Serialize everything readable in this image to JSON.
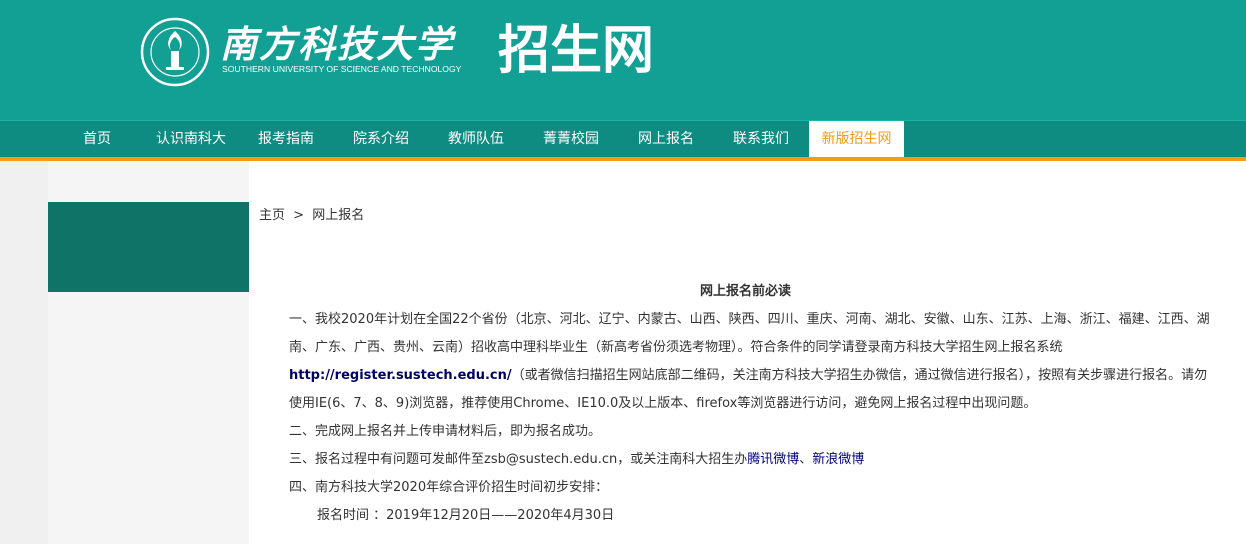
{
  "header": {
    "logo_cn": "南方科技大学",
    "logo_en": "SOUTHERN UNIVERSITY OF SCIENCE AND TECHNOLOGY",
    "site_title": "招生网"
  },
  "nav": {
    "items": [
      {
        "label": "首页"
      },
      {
        "label": "认识南科大"
      },
      {
        "label": "报考指南"
      },
      {
        "label": "院系介绍"
      },
      {
        "label": "教师队伍"
      },
      {
        "label": "菁菁校园"
      },
      {
        "label": "网上报名"
      },
      {
        "label": "联系我们"
      },
      {
        "label": "新版招生网"
      }
    ],
    "active_color": "#f39b18"
  },
  "breadcrumb": {
    "home": "主页",
    "sep": ">",
    "current": "网上报名"
  },
  "notice": {
    "title": "网上报名前必读",
    "p1_text": "一、我校2020年计划在全国22个省份（北京、河北、辽宁、内蒙古、山西、陕西、四川、重庆、河南、湖北、安徽、山东、江苏、上海、浙江、福建、江西、湖南、广东、广西、贵州、云南）招收高中理科毕业生（新高考省份须选考物理）。符合条件的同学请登录南方科技大学招生网上报名系统",
    "p1_link": "http://register.sustech.edu.cn/",
    "p1_tail": "（或者微信扫描招生网站底部二维码，关注南方科技大学招生办微信，通过微信进行报名），按照有关步骤进行报名。请勿使用IE(6、7、8、9)浏览器，推荐使用Chrome、IE10.0及以上版本、firefox等浏览器进行访问，避免网上报名过程中出现问题。",
    "p2": "二、完成网上报名并上传申请材料后，即为报名成功。",
    "p3_text": "三、报名过程中有问题可发邮件至zsb@sustech.edu.cn，或关注南科大招生办",
    "p3_link1": "腾讯微博",
    "p3_sep": "、",
    "p3_link2": "新浪微博",
    "p4": "四、南方科技大学2020年综合评价招生时间初步安排：",
    "p5": "报名时间 ：2019年12月20日——2020年4月30日"
  },
  "colors": {
    "header_bg": "#11a093",
    "nav_bg": "#0f8c81",
    "accent_orange": "#f39b18",
    "sidebar_green": "#0f7368"
  }
}
